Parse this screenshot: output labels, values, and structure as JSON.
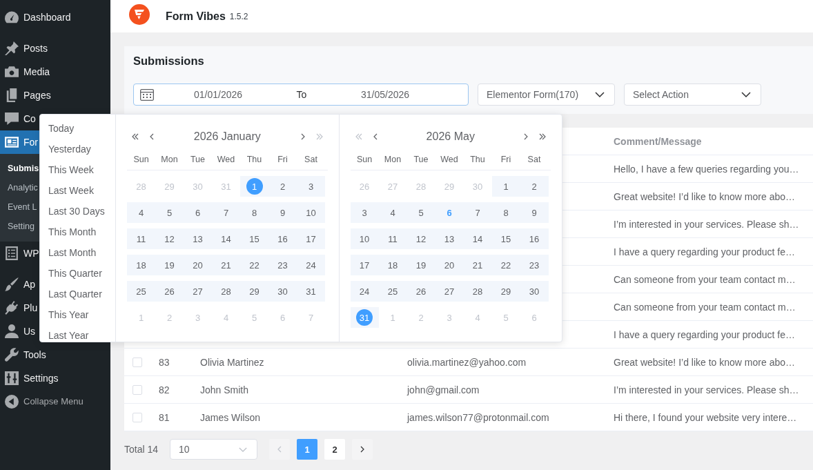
{
  "admin_menu": {
    "groups": [
      [
        {
          "label": "Dashboard",
          "selected": false
        }
      ],
      [
        {
          "label": "Posts",
          "selected": false
        },
        {
          "label": "Media",
          "selected": false
        },
        {
          "label": "Pages",
          "selected": false
        },
        {
          "label": "Co",
          "selected": false
        },
        {
          "label": "For",
          "selected": true,
          "children": [
            {
              "label": "Submis",
              "selected": true
            },
            {
              "label": "Analytic",
              "selected": false
            },
            {
              "label": "Event L",
              "selected": false
            },
            {
              "label": "Setting",
              "selected": false
            }
          ]
        },
        {
          "label": "WP",
          "selected": false
        }
      ],
      [
        {
          "label": "Ap",
          "selected": false
        },
        {
          "label": "Plu",
          "selected": false
        },
        {
          "label": "Us",
          "selected": false
        },
        {
          "label": "Tools",
          "selected": false
        },
        {
          "label": "Settings",
          "selected": false
        }
      ]
    ],
    "collapse": "Collapse Menu"
  },
  "header": {
    "plugin_name": "Form Vibes",
    "version": "1.5.2"
  },
  "submissions": {
    "title": "Submissions",
    "date_range": {
      "start": "01/01/2026",
      "separator": "To",
      "end": "31/05/2026",
      "focused": true
    },
    "form_select": {
      "value": "Elementor Form(170)"
    },
    "action_select": {
      "value": "Select Action"
    }
  },
  "date_picker": {
    "presets": [
      {
        "label": "Today",
        "selected": false
      },
      {
        "label": "Yesterday",
        "selected": false
      },
      {
        "label": "This Week",
        "selected": false
      },
      {
        "label": "Last Week",
        "selected": false
      },
      {
        "label": "Last 30 Days",
        "selected": false
      },
      {
        "label": "This Month",
        "selected": false
      },
      {
        "label": "Last Month",
        "selected": false
      },
      {
        "label": "This Quarter",
        "selected": false
      },
      {
        "label": "Last Quarter",
        "selected": false
      },
      {
        "label": "This Year",
        "selected": false
      },
      {
        "label": "Last Year",
        "selected": false
      }
    ],
    "calendars": [
      {
        "title": "2026 January",
        "nav": [
          {
            "kind": "prev-year",
            "disabled": false
          },
          {
            "kind": "prev-month",
            "disabled": false
          },
          {
            "kind": "next-month",
            "disabled": false
          },
          {
            "kind": "next-year",
            "disabled": true
          }
        ],
        "weekdays": [
          "Sun",
          "Mon",
          "Tue",
          "Wed",
          "Thu",
          "Fri",
          "Sat"
        ],
        "weeks": [
          [
            {
              "day": "28",
              "outside": true,
              "in_range": false,
              "selected": false,
              "today": false
            },
            {
              "day": "29",
              "outside": true,
              "in_range": false,
              "selected": false,
              "today": false
            },
            {
              "day": "30",
              "outside": true,
              "in_range": false,
              "selected": false,
              "today": false
            },
            {
              "day": "31",
              "outside": true,
              "in_range": false,
              "selected": false,
              "today": false
            },
            {
              "day": "1",
              "outside": false,
              "in_range": true,
              "selected": true,
              "today": false
            },
            {
              "day": "2",
              "outside": false,
              "in_range": true,
              "selected": false,
              "today": false
            },
            {
              "day": "3",
              "outside": false,
              "in_range": true,
              "selected": false,
              "today": false
            }
          ],
          [
            {
              "day": "4",
              "outside": false,
              "in_range": true,
              "selected": false,
              "today": false
            },
            {
              "day": "5",
              "outside": false,
              "in_range": true,
              "selected": false,
              "today": false
            },
            {
              "day": "6",
              "outside": false,
              "in_range": true,
              "selected": false,
              "today": false
            },
            {
              "day": "7",
              "outside": false,
              "in_range": true,
              "selected": false,
              "today": false
            },
            {
              "day": "8",
              "outside": false,
              "in_range": true,
              "selected": false,
              "today": false
            },
            {
              "day": "9",
              "outside": false,
              "in_range": true,
              "selected": false,
              "today": false
            },
            {
              "day": "10",
              "outside": false,
              "in_range": true,
              "selected": false,
              "today": false
            }
          ],
          [
            {
              "day": "11",
              "outside": false,
              "in_range": true,
              "selected": false,
              "today": false
            },
            {
              "day": "12",
              "outside": false,
              "in_range": true,
              "selected": false,
              "today": false
            },
            {
              "day": "13",
              "outside": false,
              "in_range": true,
              "selected": false,
              "today": false
            },
            {
              "day": "14",
              "outside": false,
              "in_range": true,
              "selected": false,
              "today": false
            },
            {
              "day": "15",
              "outside": false,
              "in_range": true,
              "selected": false,
              "today": false
            },
            {
              "day": "16",
              "outside": false,
              "in_range": true,
              "selected": false,
              "today": false
            },
            {
              "day": "17",
              "outside": false,
              "in_range": true,
              "selected": false,
              "today": false
            }
          ],
          [
            {
              "day": "18",
              "outside": false,
              "in_range": true,
              "selected": false,
              "today": false
            },
            {
              "day": "19",
              "outside": false,
              "in_range": true,
              "selected": false,
              "today": false
            },
            {
              "day": "20",
              "outside": false,
              "in_range": true,
              "selected": false,
              "today": false
            },
            {
              "day": "21",
              "outside": false,
              "in_range": true,
              "selected": false,
              "today": false
            },
            {
              "day": "22",
              "outside": false,
              "in_range": true,
              "selected": false,
              "today": false
            },
            {
              "day": "23",
              "outside": false,
              "in_range": true,
              "selected": false,
              "today": false
            },
            {
              "day": "24",
              "outside": false,
              "in_range": true,
              "selected": false,
              "today": false
            }
          ],
          [
            {
              "day": "25",
              "outside": false,
              "in_range": true,
              "selected": false,
              "today": false
            },
            {
              "day": "26",
              "outside": false,
              "in_range": true,
              "selected": false,
              "today": false
            },
            {
              "day": "27",
              "outside": false,
              "in_range": true,
              "selected": false,
              "today": false
            },
            {
              "day": "28",
              "outside": false,
              "in_range": true,
              "selected": false,
              "today": false
            },
            {
              "day": "29",
              "outside": false,
              "in_range": true,
              "selected": false,
              "today": false
            },
            {
              "day": "30",
              "outside": false,
              "in_range": true,
              "selected": false,
              "today": false
            },
            {
              "day": "31",
              "outside": false,
              "in_range": true,
              "selected": false,
              "today": false
            }
          ],
          [
            {
              "day": "1",
              "outside": true,
              "in_range": false,
              "selected": false,
              "today": false
            },
            {
              "day": "2",
              "outside": true,
              "in_range": false,
              "selected": false,
              "today": false
            },
            {
              "day": "3",
              "outside": true,
              "in_range": false,
              "selected": false,
              "today": false
            },
            {
              "day": "4",
              "outside": true,
              "in_range": false,
              "selected": false,
              "today": false
            },
            {
              "day": "5",
              "outside": true,
              "in_range": false,
              "selected": false,
              "today": false
            },
            {
              "day": "6",
              "outside": true,
              "in_range": false,
              "selected": false,
              "today": false
            },
            {
              "day": "7",
              "outside": true,
              "in_range": false,
              "selected": false,
              "today": false
            }
          ]
        ]
      },
      {
        "title": "2026 May",
        "nav": [
          {
            "kind": "prev-year",
            "disabled": true
          },
          {
            "kind": "prev-month",
            "disabled": false
          },
          {
            "kind": "next-month",
            "disabled": false
          },
          {
            "kind": "next-year",
            "disabled": false
          }
        ],
        "weekdays": [
          "Sun",
          "Mon",
          "Tue",
          "Wed",
          "Thu",
          "Fri",
          "Sat"
        ],
        "weeks": [
          [
            {
              "day": "26",
              "outside": true,
              "in_range": false,
              "selected": false,
              "today": false
            },
            {
              "day": "27",
              "outside": true,
              "in_range": false,
              "selected": false,
              "today": false
            },
            {
              "day": "28",
              "outside": true,
              "in_range": false,
              "selected": false,
              "today": false
            },
            {
              "day": "29",
              "outside": true,
              "in_range": false,
              "selected": false,
              "today": false
            },
            {
              "day": "30",
              "outside": true,
              "in_range": false,
              "selected": false,
              "today": false
            },
            {
              "day": "1",
              "outside": false,
              "in_range": true,
              "selected": false,
              "today": false
            },
            {
              "day": "2",
              "outside": false,
              "in_range": true,
              "selected": false,
              "today": false
            }
          ],
          [
            {
              "day": "3",
              "outside": false,
              "in_range": true,
              "selected": false,
              "today": false
            },
            {
              "day": "4",
              "outside": false,
              "in_range": true,
              "selected": false,
              "today": false
            },
            {
              "day": "5",
              "outside": false,
              "in_range": true,
              "selected": false,
              "today": false
            },
            {
              "day": "6",
              "outside": false,
              "in_range": true,
              "selected": false,
              "today": true
            },
            {
              "day": "7",
              "outside": false,
              "in_range": true,
              "selected": false,
              "today": false
            },
            {
              "day": "8",
              "outside": false,
              "in_range": true,
              "selected": false,
              "today": false
            },
            {
              "day": "9",
              "outside": false,
              "in_range": true,
              "selected": false,
              "today": false
            }
          ],
          [
            {
              "day": "10",
              "outside": false,
              "in_range": true,
              "selected": false,
              "today": false
            },
            {
              "day": "11",
              "outside": false,
              "in_range": true,
              "selected": false,
              "today": false
            },
            {
              "day": "12",
              "outside": false,
              "in_range": true,
              "selected": false,
              "today": false
            },
            {
              "day": "13",
              "outside": false,
              "in_range": true,
              "selected": false,
              "today": false
            },
            {
              "day": "14",
              "outside": false,
              "in_range": true,
              "selected": false,
              "today": false
            },
            {
              "day": "15",
              "outside": false,
              "in_range": true,
              "selected": false,
              "today": false
            },
            {
              "day": "16",
              "outside": false,
              "in_range": true,
              "selected": false,
              "today": false
            }
          ],
          [
            {
              "day": "17",
              "outside": false,
              "in_range": true,
              "selected": false,
              "today": false
            },
            {
              "day": "18",
              "outside": false,
              "in_range": true,
              "selected": false,
              "today": false
            },
            {
              "day": "19",
              "outside": false,
              "in_range": true,
              "selected": false,
              "today": false
            },
            {
              "day": "20",
              "outside": false,
              "in_range": true,
              "selected": false,
              "today": false
            },
            {
              "day": "21",
              "outside": false,
              "in_range": true,
              "selected": false,
              "today": false
            },
            {
              "day": "22",
              "outside": false,
              "in_range": true,
              "selected": false,
              "today": false
            },
            {
              "day": "23",
              "outside": false,
              "in_range": true,
              "selected": false,
              "today": false
            }
          ],
          [
            {
              "day": "24",
              "outside": false,
              "in_range": true,
              "selected": false,
              "today": false
            },
            {
              "day": "25",
              "outside": false,
              "in_range": true,
              "selected": false,
              "today": false
            },
            {
              "day": "26",
              "outside": false,
              "in_range": true,
              "selected": false,
              "today": false
            },
            {
              "day": "27",
              "outside": false,
              "in_range": true,
              "selected": false,
              "today": false
            },
            {
              "day": "28",
              "outside": false,
              "in_range": true,
              "selected": false,
              "today": false
            },
            {
              "day": "29",
              "outside": false,
              "in_range": true,
              "selected": false,
              "today": false
            },
            {
              "day": "30",
              "outside": false,
              "in_range": true,
              "selected": false,
              "today": false
            }
          ],
          [
            {
              "day": "31",
              "outside": false,
              "in_range": true,
              "selected": true,
              "today": false
            },
            {
              "day": "1",
              "outside": true,
              "in_range": false,
              "selected": false,
              "today": false
            },
            {
              "day": "2",
              "outside": true,
              "in_range": false,
              "selected": false,
              "today": false
            },
            {
              "day": "3",
              "outside": true,
              "in_range": false,
              "selected": false,
              "today": false
            },
            {
              "day": "4",
              "outside": true,
              "in_range": false,
              "selected": false,
              "today": false
            },
            {
              "day": "5",
              "outside": true,
              "in_range": false,
              "selected": false,
              "today": false
            },
            {
              "day": "6",
              "outside": true,
              "in_range": false,
              "selected": false,
              "today": false
            }
          ]
        ]
      }
    ]
  },
  "table": {
    "comment_heading": "Comment/Message",
    "rows": [
      {
        "comment": "Hello, I have a few queries regarding you…"
      },
      {
        "comment": "Great website! I’d like to know more abo…"
      },
      {
        "comment": "I’m interested in your services. Please sh…"
      },
      {
        "comment": "I have a query regarding your product fe…"
      },
      {
        "comment": "Can someone from your team contact m…"
      },
      {
        "comment": "Can someone from your team contact m…"
      },
      {
        "comment": "I have a query regarding your product fe…"
      },
      {
        "checked": false,
        "id": "83",
        "name": "Olivia Martinez",
        "email": "olivia.martinez@yahoo.com",
        "comment": "Great website! I’d like to know more abo…"
      },
      {
        "checked": false,
        "id": "82",
        "name": "John Smith",
        "email": "john@gmail.com",
        "comment": "I’m interested in your services. Please sh…"
      },
      {
        "checked": false,
        "id": "81",
        "name": "James Wilson",
        "email": "james.wilson77@protonmail.com",
        "comment": "Hi there, I found your website very intere…"
      }
    ]
  },
  "pagination": {
    "total": "Total 14",
    "page_size": "10",
    "prev_disabled": true,
    "pages": [
      {
        "label": "1",
        "selected": true
      },
      {
        "label": "2",
        "selected": false
      }
    ],
    "next_disabled": false
  }
}
